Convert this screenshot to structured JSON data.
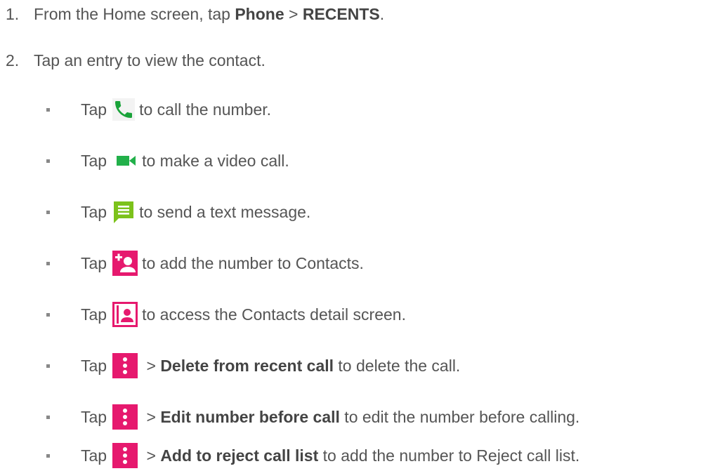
{
  "steps": [
    {
      "num": "1.",
      "pre": "From the Home screen, tap ",
      "b1": "Phone",
      "mid": " > ",
      "b2": "RECENTS",
      "post": "."
    },
    {
      "num": "2.",
      "text": "Tap an entry to view the contact."
    }
  ],
  "bullets": [
    {
      "tap": "Tap",
      "icon": "phone-icon",
      "rest": " to call the number."
    },
    {
      "tap": "Tap",
      "icon": "video-call-icon",
      "rest": " to make a video call."
    },
    {
      "tap": "Tap",
      "icon": "message-icon",
      "rest": " to send a text message."
    },
    {
      "tap": "Tap",
      "icon": "add-contact-icon",
      "rest": " to add the number to Contacts."
    },
    {
      "tap": "Tap",
      "icon": "contact-card-icon",
      "rest": " to access the Contacts detail screen."
    },
    {
      "tap": "Tap",
      "icon": "more-options-icon",
      "gt": " > ",
      "bold": "Delete from recent call",
      "rest": " to delete the call."
    },
    {
      "tap": "Tap",
      "icon": "more-options-icon",
      "gt": " > ",
      "bold": "Edit number before call",
      "rest": " to edit the number before calling."
    },
    {
      "tap": "Tap",
      "icon": "more-options-icon",
      "gt": " > ",
      "bold": "Add to reject call list",
      "rest": " to add the number to Reject call list."
    }
  ],
  "colors": {
    "text": "#555555",
    "phone_green": "#1aa33a",
    "video_green": "#22b04a",
    "message_green": "#7cc21b",
    "accent_pink": "#e6196e"
  }
}
